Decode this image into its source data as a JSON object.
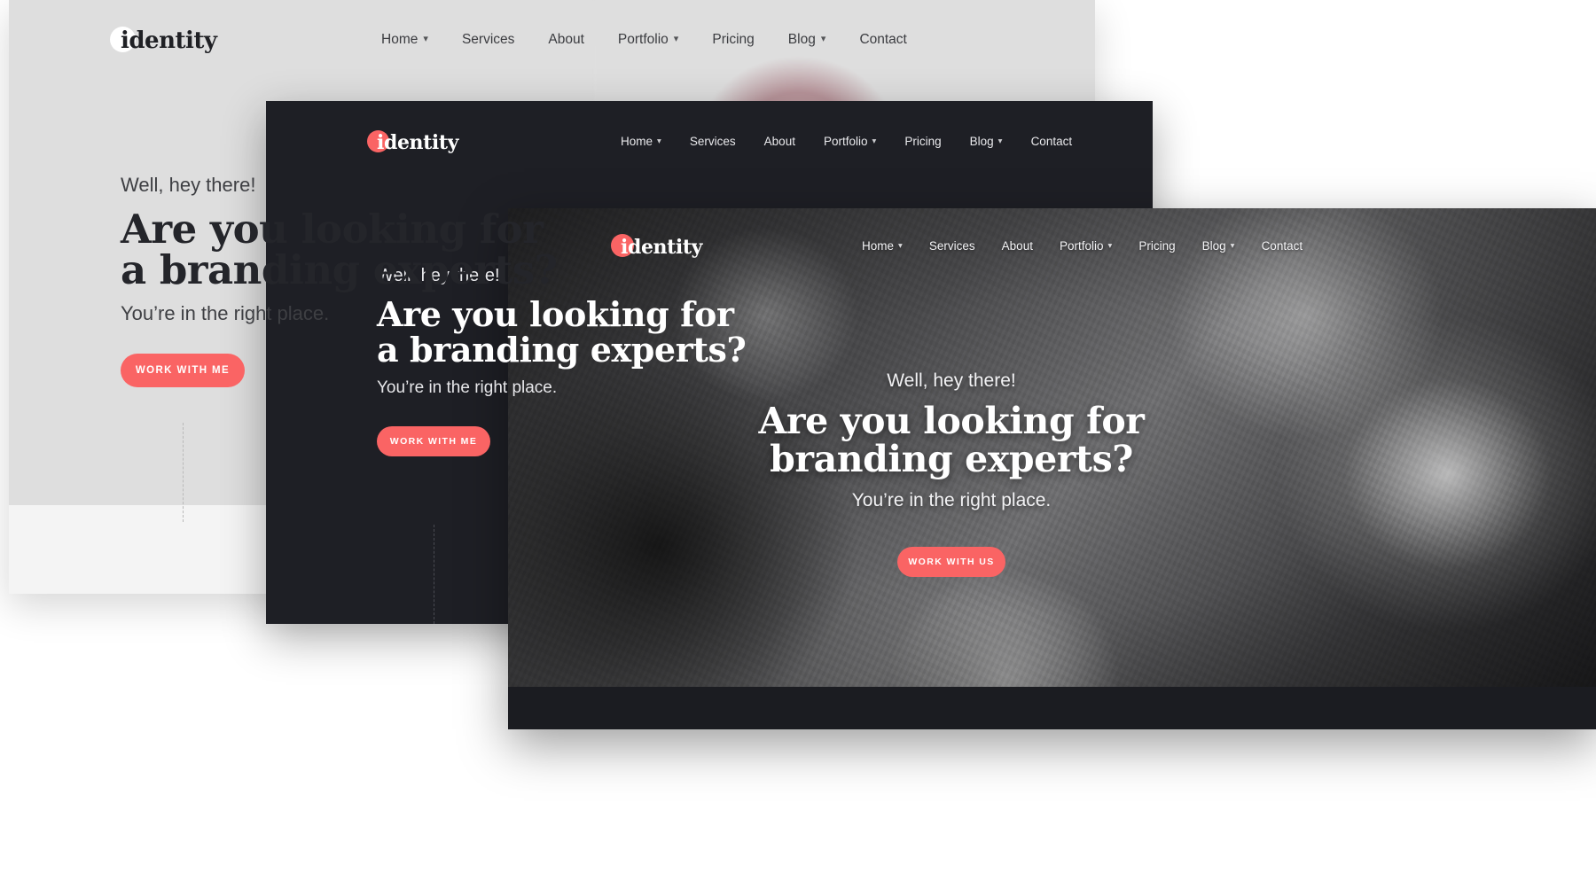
{
  "brand": {
    "name": "identity",
    "accent_color": "#fa6464",
    "logo_initial": "i",
    "logo_rest": "dentity"
  },
  "nav": {
    "items": [
      {
        "label": "Home",
        "has_dropdown": true,
        "icon": "chevron-down-icon"
      },
      {
        "label": "Services",
        "has_dropdown": false,
        "icon": ""
      },
      {
        "label": "About",
        "has_dropdown": false,
        "icon": ""
      },
      {
        "label": "Portfolio",
        "has_dropdown": true,
        "icon": "chevron-down-icon"
      },
      {
        "label": "Pricing",
        "has_dropdown": false,
        "icon": ""
      },
      {
        "label": "Blog",
        "has_dropdown": true,
        "icon": "chevron-down-icon"
      },
      {
        "label": "Contact",
        "has_dropdown": false,
        "icon": ""
      }
    ]
  },
  "layers": {
    "light": {
      "variant_name": "light-gray-hero",
      "background_color": "#dedede",
      "logo_dot_color": "#ffffff",
      "logo_text_color": "#1f2024",
      "eyebrow": "Well, hey there!",
      "title_line1": "Are you looking for",
      "title_line2": "a branding experts?",
      "subtitle": "You’re in the right place.",
      "cta_label": "WORK WITH ME"
    },
    "dark": {
      "variant_name": "dark-hero",
      "background_color": "#1e1f25",
      "logo_dot_color": "#fa6464",
      "logo_text_color": "#ffffff",
      "eyebrow": "Well, hey there!",
      "title_line1": "Are you looking for",
      "title_line2": "a branding experts?",
      "subtitle": "You’re in the right place.",
      "cta_label": "WORK WITH ME"
    },
    "photo": {
      "variant_name": "photo-background-hero",
      "background_color": "#17181c",
      "logo_dot_color": "#fa6464",
      "logo_text_color": "#ffffff",
      "eyebrow": "Well, hey there!",
      "title_line1": "Are you looking for",
      "title_line2": "branding experts?",
      "subtitle": "You’re in the right place.",
      "cta_label": "WORK WITH US"
    }
  }
}
